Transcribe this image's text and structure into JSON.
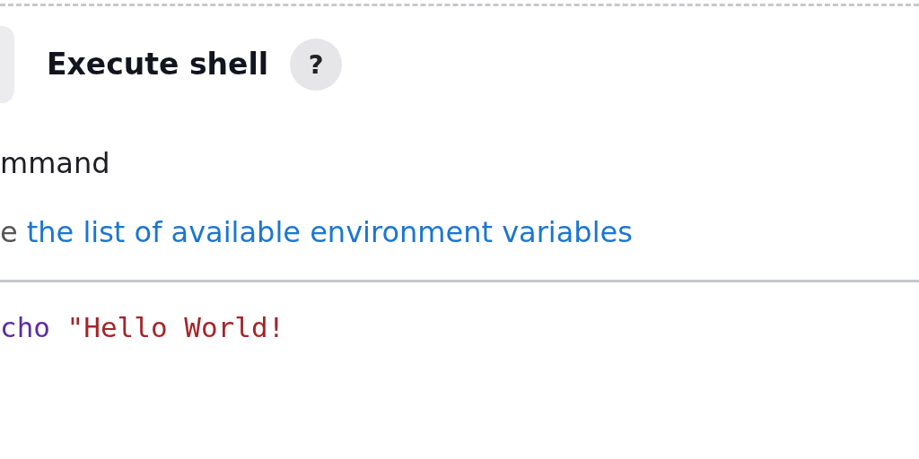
{
  "step": {
    "title": "Execute shell",
    "help": "?"
  },
  "field": {
    "label": "mmand",
    "hint_prefix": "e",
    "hint_link": "the list of available environment variables"
  },
  "editor": {
    "tokens": [
      {
        "kind": "keyword",
        "text": "cho"
      },
      {
        "kind": "string",
        "text": "\"Hello World!"
      }
    ]
  }
}
